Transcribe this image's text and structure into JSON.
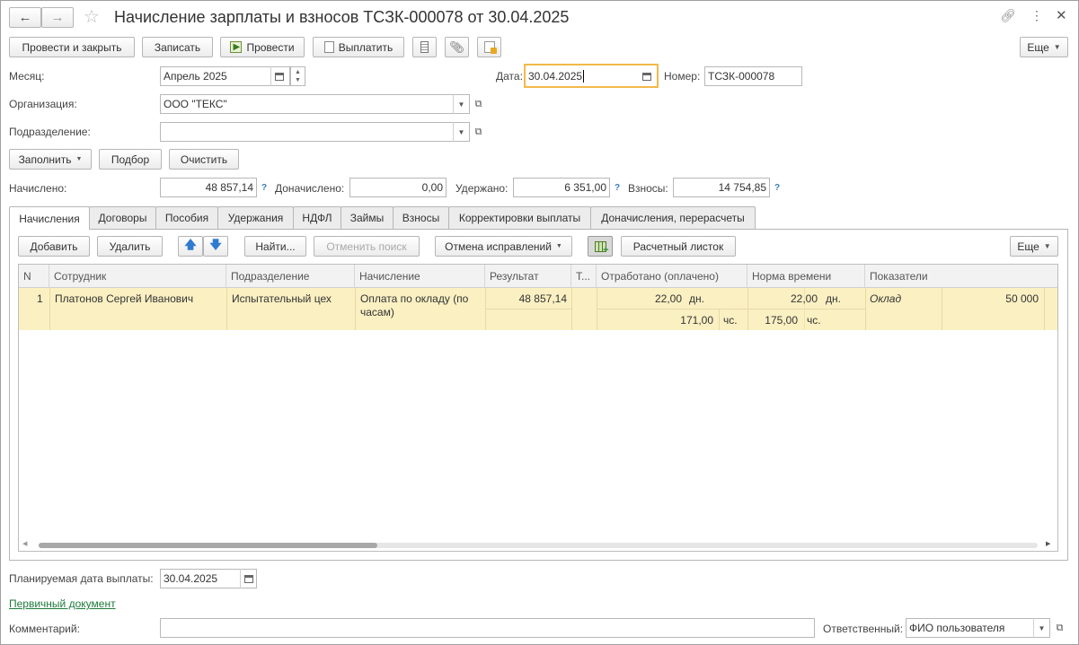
{
  "window": {
    "title": "Начисление зарплаты и взносов ТСЗК-000078 от 30.04.2025"
  },
  "toolbar": {
    "post_close": "Провести и закрыть",
    "save": "Записать",
    "post": "Провести",
    "pay": "Выплатить",
    "more": "Еще"
  },
  "header": {
    "month_label": "Месяц:",
    "month_value": "Апрель 2025",
    "date_label": "Дата:",
    "date_value": "30.04.2025",
    "number_label": "Номер:",
    "number_value": "ТСЗК-000078",
    "org_label": "Организация:",
    "org_value": "ООО \"ТЕКС\"",
    "dept_label": "Подразделение:",
    "dept_value": ""
  },
  "fill": {
    "fill": "Заполнить",
    "pick": "Подбор",
    "clear": "Очистить"
  },
  "totals": {
    "accrued_label": "Начислено:",
    "accrued_value": "48 857,14",
    "extra_label": "Доначислено:",
    "extra_value": "0,00",
    "withheld_label": "Удержано:",
    "withheld_value": "6 351,00",
    "contrib_label": "Взносы:",
    "contrib_value": "14 754,85",
    "hint": "?"
  },
  "tabs": [
    "Начисления",
    "Договоры",
    "Пособия",
    "Удержания",
    "НДФЛ",
    "Займы",
    "Взносы",
    "Корректировки выплаты",
    "Доначисления, перерасчеты"
  ],
  "grid_toolbar": {
    "add": "Добавить",
    "delete": "Удалить",
    "find": "Найти...",
    "cancel_search": "Отменить поиск",
    "undo_fix": "Отмена исправлений",
    "payslip": "Расчетный листок",
    "more": "Еще"
  },
  "columns": [
    "N",
    "Сотрудник",
    "Подразделение",
    "Начисление",
    "Результат",
    "Т...",
    "Отработано (оплачено)",
    "Норма времени",
    "Показатели"
  ],
  "rows": [
    {
      "n": "1",
      "employee": "Платонов Сергей Иванович",
      "dept": "Испытательный цех",
      "accrual_1": "Оплата по окладу (по",
      "accrual_2": "часам)",
      "result": "48 857,14",
      "worked_days": "22,00",
      "unit_days": "дн.",
      "worked_hours": "171,00",
      "unit_hours": "чс.",
      "norm_days": "22,00",
      "norm_unit_days": "дн.",
      "norm_hours": "175,00",
      "norm_unit_hours": "чс.",
      "indicator": "Оклад",
      "indicator_value": "50 000"
    }
  ],
  "footer": {
    "plan_date_label": "Планируемая дата выплаты:",
    "plan_date_value": "30.04.2025",
    "primary_doc": "Первичный документ",
    "comment_label": "Комментарий:",
    "comment_value": "",
    "responsible_label": "Ответственный:",
    "responsible_value": "ФИО пользователя"
  }
}
